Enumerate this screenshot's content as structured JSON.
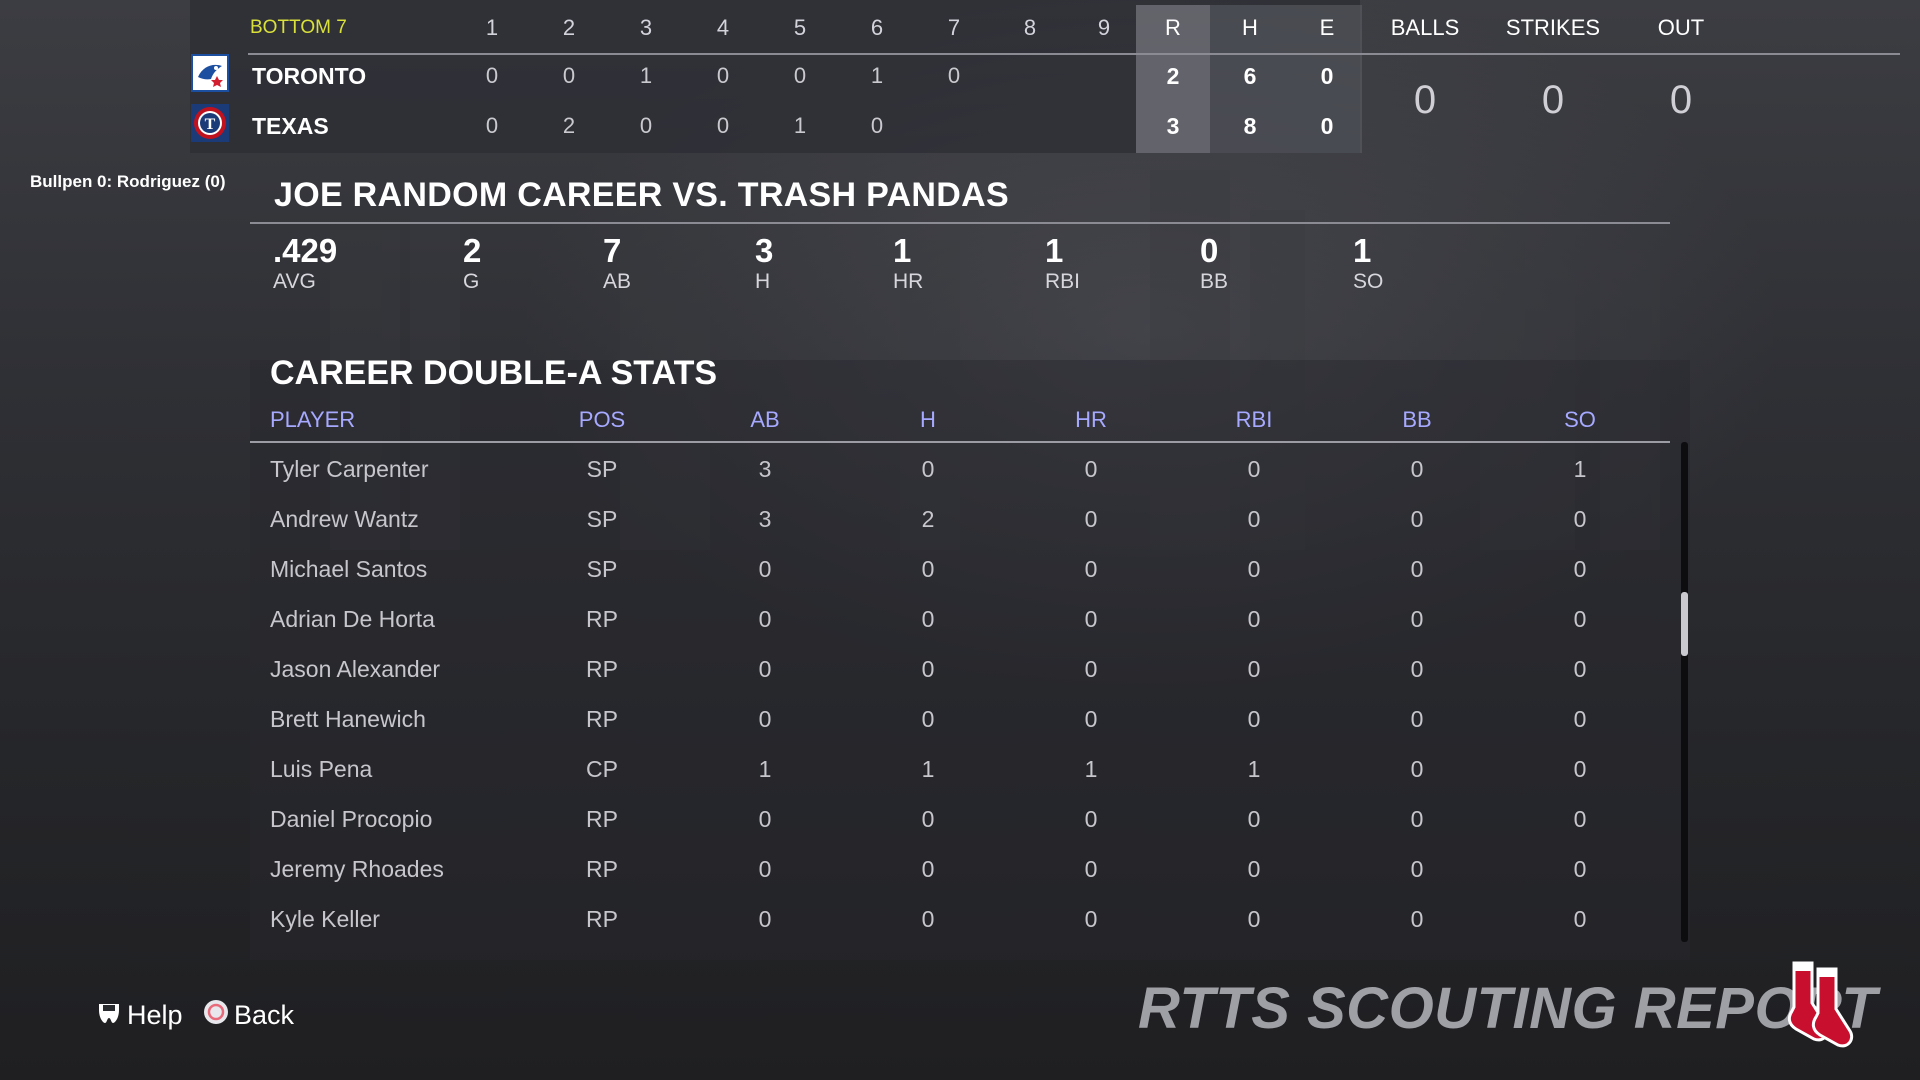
{
  "scoreboard": {
    "inning_label": "BOTTOM 7",
    "innings": [
      "1",
      "2",
      "3",
      "4",
      "5",
      "6",
      "7",
      "8",
      "9"
    ],
    "rhe_headers": [
      "R",
      "H",
      "E"
    ],
    "count_headers": [
      "BALLS",
      "STRIKES",
      "OUT"
    ],
    "count_values": [
      "0",
      "0",
      "0"
    ],
    "teams": [
      {
        "name": "TORONTO",
        "logo_icon": "blue-jays-logo-icon",
        "innings": [
          "0",
          "0",
          "1",
          "0",
          "0",
          "1",
          "0",
          "",
          ""
        ],
        "runs": "2",
        "hits": "6",
        "errors": "0"
      },
      {
        "name": "TEXAS",
        "logo_icon": "rangers-logo-icon",
        "innings": [
          "0",
          "2",
          "0",
          "0",
          "1",
          "0",
          "",
          "",
          ""
        ],
        "runs": "3",
        "hits": "8",
        "errors": "0"
      }
    ]
  },
  "bullpen": "Bullpen 0: Rodriguez (0)",
  "career_vs": {
    "title": "JOE RANDOM CAREER VS. TRASH PANDAS",
    "stats": [
      {
        "value": ".429",
        "label": "AVG"
      },
      {
        "value": "2",
        "label": "G"
      },
      {
        "value": "7",
        "label": "AB"
      },
      {
        "value": "3",
        "label": "H"
      },
      {
        "value": "1",
        "label": "HR"
      },
      {
        "value": "1",
        "label": "RBI"
      },
      {
        "value": "0",
        "label": "BB"
      },
      {
        "value": "1",
        "label": "SO"
      }
    ]
  },
  "career_table": {
    "title": "CAREER DOUBLE-A STATS",
    "headers": [
      "PLAYER",
      "POS",
      "AB",
      "H",
      "HR",
      "RBI",
      "BB",
      "SO"
    ],
    "rows": [
      [
        "Tyler Carpenter",
        "SP",
        "3",
        "0",
        "0",
        "0",
        "0",
        "1"
      ],
      [
        "Andrew Wantz",
        "SP",
        "3",
        "2",
        "0",
        "0",
        "0",
        "0"
      ],
      [
        "Michael Santos",
        "SP",
        "0",
        "0",
        "0",
        "0",
        "0",
        "0"
      ],
      [
        "Adrian De Horta",
        "RP",
        "0",
        "0",
        "0",
        "0",
        "0",
        "0"
      ],
      [
        "Jason Alexander",
        "RP",
        "0",
        "0",
        "0",
        "0",
        "0",
        "0"
      ],
      [
        "Brett Hanewich",
        "RP",
        "0",
        "0",
        "0",
        "0",
        "0",
        "0"
      ],
      [
        "Luis Pena",
        "CP",
        "1",
        "1",
        "1",
        "1",
        "0",
        "0"
      ],
      [
        "Daniel Procopio",
        "RP",
        "0",
        "0",
        "0",
        "0",
        "0",
        "0"
      ],
      [
        "Jeremy Rhoades",
        "RP",
        "0",
        "0",
        "0",
        "0",
        "0",
        "0"
      ],
      [
        "Kyle Keller",
        "RP",
        "0",
        "0",
        "0",
        "0",
        "0",
        "0"
      ]
    ]
  },
  "footer": {
    "help_label": "Help",
    "help_icon": "touchpad-icon",
    "back_label": "Back",
    "back_icon": "circle-button-icon",
    "brand": "RTTS SCOUTING REPORT",
    "brand_logo": "red-sox-logo-icon"
  },
  "colors": {
    "inning_label": "#d9e03a",
    "table_header": "#a6a9ff",
    "red_sox": "#c8102e"
  }
}
